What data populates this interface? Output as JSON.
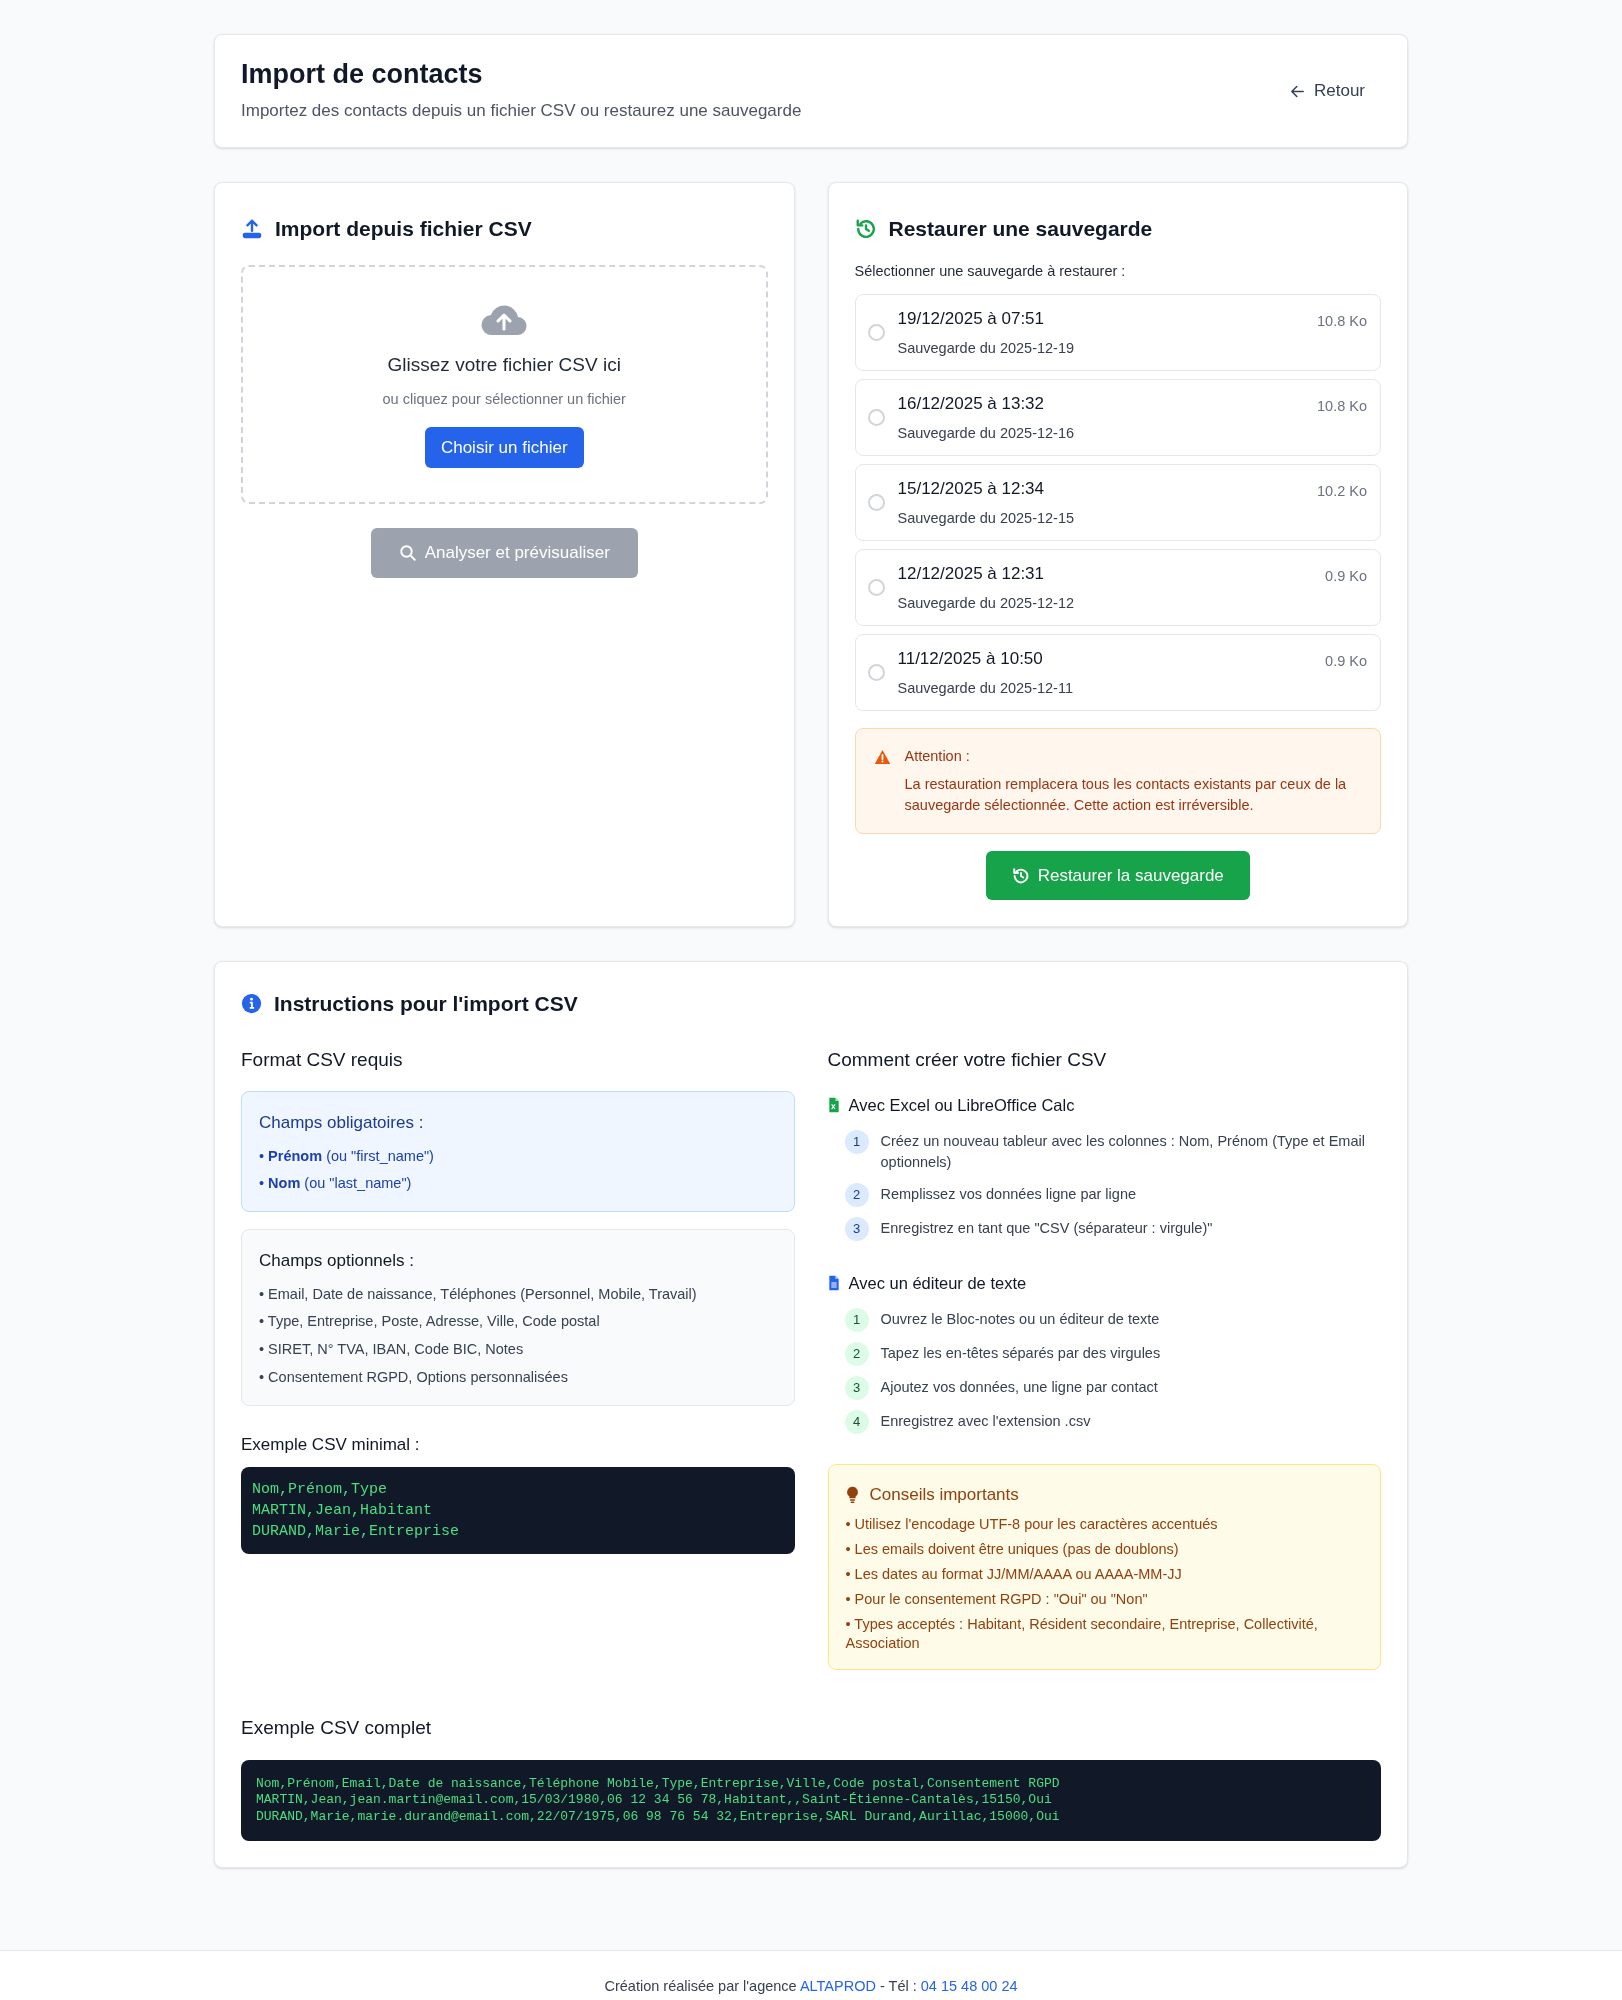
{
  "header": {
    "title": "Import de contacts",
    "subtitle": "Importez des contacts depuis un fichier CSV ou restaurez une sauvegarde",
    "back_label": "Retour"
  },
  "csv_import": {
    "title": "Import depuis fichier CSV",
    "drop_title": "Glissez votre fichier CSV ici",
    "drop_hint": "ou cliquez pour sélectionner un fichier",
    "choose_button": "Choisir un fichier",
    "analyze_button": {
      "label": "Analyser et prévisualiser",
      "disabled": true
    }
  },
  "restore": {
    "title": "Restaurer une sauvegarde",
    "prompt": "Sélectionner une sauvegarde à restaurer :",
    "backups": [
      {
        "date": "19/12/2025 à 07:51",
        "description": "Sauvegarde du 2025-12-19",
        "size": "10.8 Ko",
        "selected": false
      },
      {
        "date": "16/12/2025 à 13:32",
        "description": "Sauvegarde du 2025-12-16",
        "size": "10.8 Ko",
        "selected": false
      },
      {
        "date": "15/12/2025 à 12:34",
        "description": "Sauvegarde du 2025-12-15",
        "size": "10.2 Ko",
        "selected": false
      },
      {
        "date": "12/12/2025 à 12:31",
        "description": "Sauvegarde du 2025-12-12",
        "size": "0.9 Ko",
        "selected": false
      },
      {
        "date": "11/12/2025 à 10:50",
        "description": "Sauvegarde du 2025-12-11",
        "size": "0.9 Ko",
        "selected": false
      }
    ],
    "warning": {
      "title": "Attention :",
      "message": "La restauration remplacera tous les contacts existants par ceux de la sauvegarde sélectionnée. Cette action est irréversible."
    },
    "restore_button": "Restaurer la sauvegarde"
  },
  "instructions": {
    "title": "Instructions pour l'import CSV",
    "format": {
      "heading": "Format CSV requis",
      "required": {
        "title": "Champs obligatoires :",
        "items": [
          "• **Prénom** (ou \"first_name\")",
          "• **Nom** (ou \"last_name\")"
        ]
      },
      "optional": {
        "title": "Champs optionnels :",
        "items": [
          "• Email, Date de naissance, Téléphones (Personnel, Mobile, Travail)",
          "• Type, Entreprise, Poste, Adresse, Ville, Code postal",
          "• SIRET, N° TVA, IBAN, Code BIC, Notes",
          "• Consentement RGPD, Options personnalisées"
        ]
      },
      "minimal_example": {
        "label": "Exemple CSV minimal :",
        "lines": [
          "Nom,Prénom,Type",
          "MARTIN,Jean,Habitant",
          "DURAND,Marie,Entreprise"
        ]
      }
    },
    "how_to": {
      "heading": "Comment créer votre fichier CSV",
      "methods": [
        {
          "kind": "spreadsheet",
          "title": "Avec Excel ou LibreOffice Calc",
          "steps": [
            {
              "number": "1",
              "text": "Créez un nouveau tableur avec les colonnes : Nom, Prénom (Type et Email optionnels)"
            },
            {
              "number": "2",
              "text": "Remplissez vos données ligne par ligne"
            },
            {
              "number": "3",
              "text": "Enregistrez en tant que \"CSV (séparateur : virgule)\""
            }
          ]
        },
        {
          "kind": "text",
          "title": "Avec un éditeur de texte",
          "steps": [
            {
              "number": "1",
              "text": "Ouvrez le Bloc-notes ou un éditeur de texte"
            },
            {
              "number": "2",
              "text": "Tapez les en-têtes séparés par des virgules"
            },
            {
              "number": "3",
              "text": "Ajoutez vos données, une ligne par contact"
            },
            {
              "number": "4",
              "text": "Enregistrez avec l'extension .csv"
            }
          ]
        }
      ],
      "tips": {
        "title": "Conseils importants",
        "items": [
          "• Utilisez l'encodage UTF-8 pour les caractères accentués",
          "• Les emails doivent être uniques (pas de doublons)",
          "• Les dates au format JJ/MM/AAAA ou AAAA-MM-JJ",
          "• Pour le consentement RGPD : \"Oui\" ou \"Non\"",
          "• Types acceptés : Habitant, Résident secondaire, Entreprise, Collectivité, Association"
        ]
      }
    },
    "complete_example": {
      "label": "Exemple CSV complet",
      "lines": [
        "Nom,Prénom,Email,Date de naissance,Téléphone Mobile,Type,Entreprise,Ville,Code postal,Consentement RGPD",
        "MARTIN,Jean,jean.martin@email.com,15/03/1980,06 12 34 56 78,Habitant,,Saint-Étienne-Cantalès,15150,Oui",
        "DURAND,Marie,marie.durand@email.com,22/07/1975,06 98 76 54 32,Entreprise,SARL Durand,Aurillac,15000,Oui"
      ]
    }
  },
  "footer": {
    "prefix": "Création réalisée par l'agence",
    "agency": "ALTAPROD",
    "separator": "- Tél :",
    "phone": "04 15 48 00 24"
  }
}
